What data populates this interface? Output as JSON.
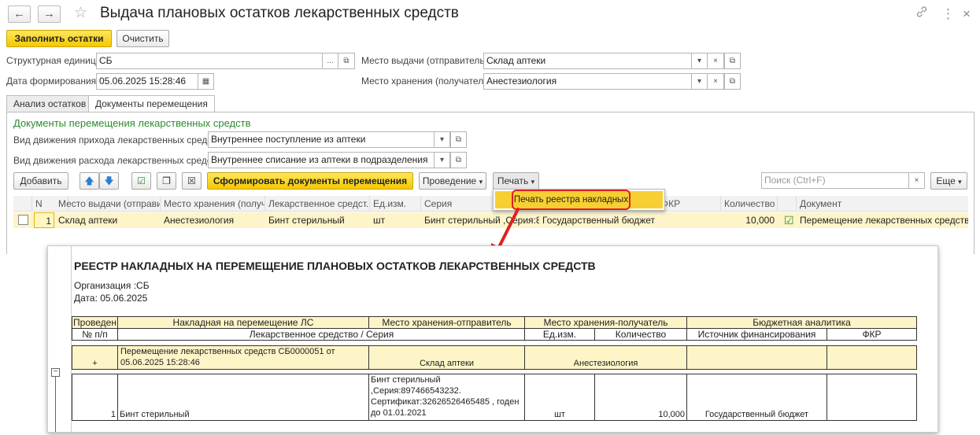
{
  "window": {
    "title": "Выдача плановых остатков лекарственных средств",
    "back_icon": "←",
    "forward_icon": "→",
    "star_icon": "☆",
    "link_icon": "🔗",
    "menu_icon": "⋮",
    "close_icon": "×"
  },
  "toolbar": {
    "fill_label": "Заполнить остатки",
    "clear_label": "Очистить"
  },
  "form": {
    "unit_label": "Структурная единица:",
    "unit_value": "СБ",
    "date_label": "Дата формирования:",
    "date_value": "05.06.2025 15:28:46",
    "issue_label": "Место выдачи (отправитель):",
    "issue_value": "Склад аптеки",
    "store_label": "Место хранения (получатель):",
    "store_value": "Анестезиология"
  },
  "tabs": [
    {
      "label": "Анализ остатков"
    },
    {
      "label": "Документы перемещения"
    }
  ],
  "section": {
    "title": "Документы перемещения  лекарственных средств",
    "in_label": "Вид движения прихода лекарственных средств:",
    "in_value": "Внутреннее поступление из аптеки",
    "out_label": "Вид движения расхода лекарственных средств:",
    "out_value": "Внутреннее списание из аптеки в подразделения"
  },
  "cmd": {
    "add_label": "Добавить",
    "form_docs_label": "Сформировать документы перемещения",
    "posting_label": "Проведение",
    "print_label": "Печать",
    "search_placeholder": "Поиск (Ctrl+F)",
    "more_label": "Еще"
  },
  "popup": {
    "item_label": "Печать реестра накладных"
  },
  "grid": {
    "headers": [
      "N",
      "Место выдачи (отправи...",
      "Место хранения (получ...",
      "Лекарственное средст...",
      "Ед.изм.",
      "Серия",
      "ФКР",
      "Количество",
      "Документ"
    ],
    "row": {
      "n": "1",
      "issue": "Склад аптеки",
      "store": "Анестезиология",
      "drug": "Бинт стерильный",
      "unit": "шт",
      "series": "Бинт стерильный ,Серия:8...",
      "budget": "Государственный бюджет",
      "qty": "10,000",
      "doc": "Перемещение лекарственных средств СБ"
    }
  },
  "report": {
    "title": "РЕЕСТР  НАКЛАДНЫХ НА  ПЕРЕМЕЩЕНИЕ ПЛАНОВЫХ ОСТАТКОВ  ЛЕКАРСТВЕННЫХ СРЕДСТВ",
    "org": "Организация :СБ",
    "date": "Дата: 05.06.2025",
    "h1": [
      "Проведен",
      "Накладная на перемещение ЛС",
      "Место хранения-отправитель",
      "Место хранения-получатель",
      "Бюджетная аналитика"
    ],
    "h2": [
      "№ п/п",
      "Лекарственное средство / Серия",
      "Ед.изм.",
      "Количество",
      "Источник финансирования",
      "ФКР"
    ],
    "group": {
      "sign": "+",
      "doc_line1": "Перемещение лекарственных средств СБ0000051 от",
      "doc_line2": "05.06.2025 15:28:46",
      "sender": "Склад аптеки",
      "receiver": "Анестезиология"
    },
    "detail": {
      "n": "1",
      "drug": "Бинт стерильный",
      "series_l1": "Бинт стерильный",
      "series_l2": ",Серия:897466543232.",
      "series_l3": "Сертификат:32626526465485 , годен",
      "series_l4": "до 01.01.2021",
      "unit": "шт",
      "qty": "10,000",
      "source": "Государственный бюджет"
    },
    "collapse_sign": "−"
  },
  "colors": {
    "accent_yellow": "#f5c800",
    "section_green": "#2e8b2e",
    "arrow_red": "#e02020",
    "row_highlight": "#fdf4c9"
  }
}
